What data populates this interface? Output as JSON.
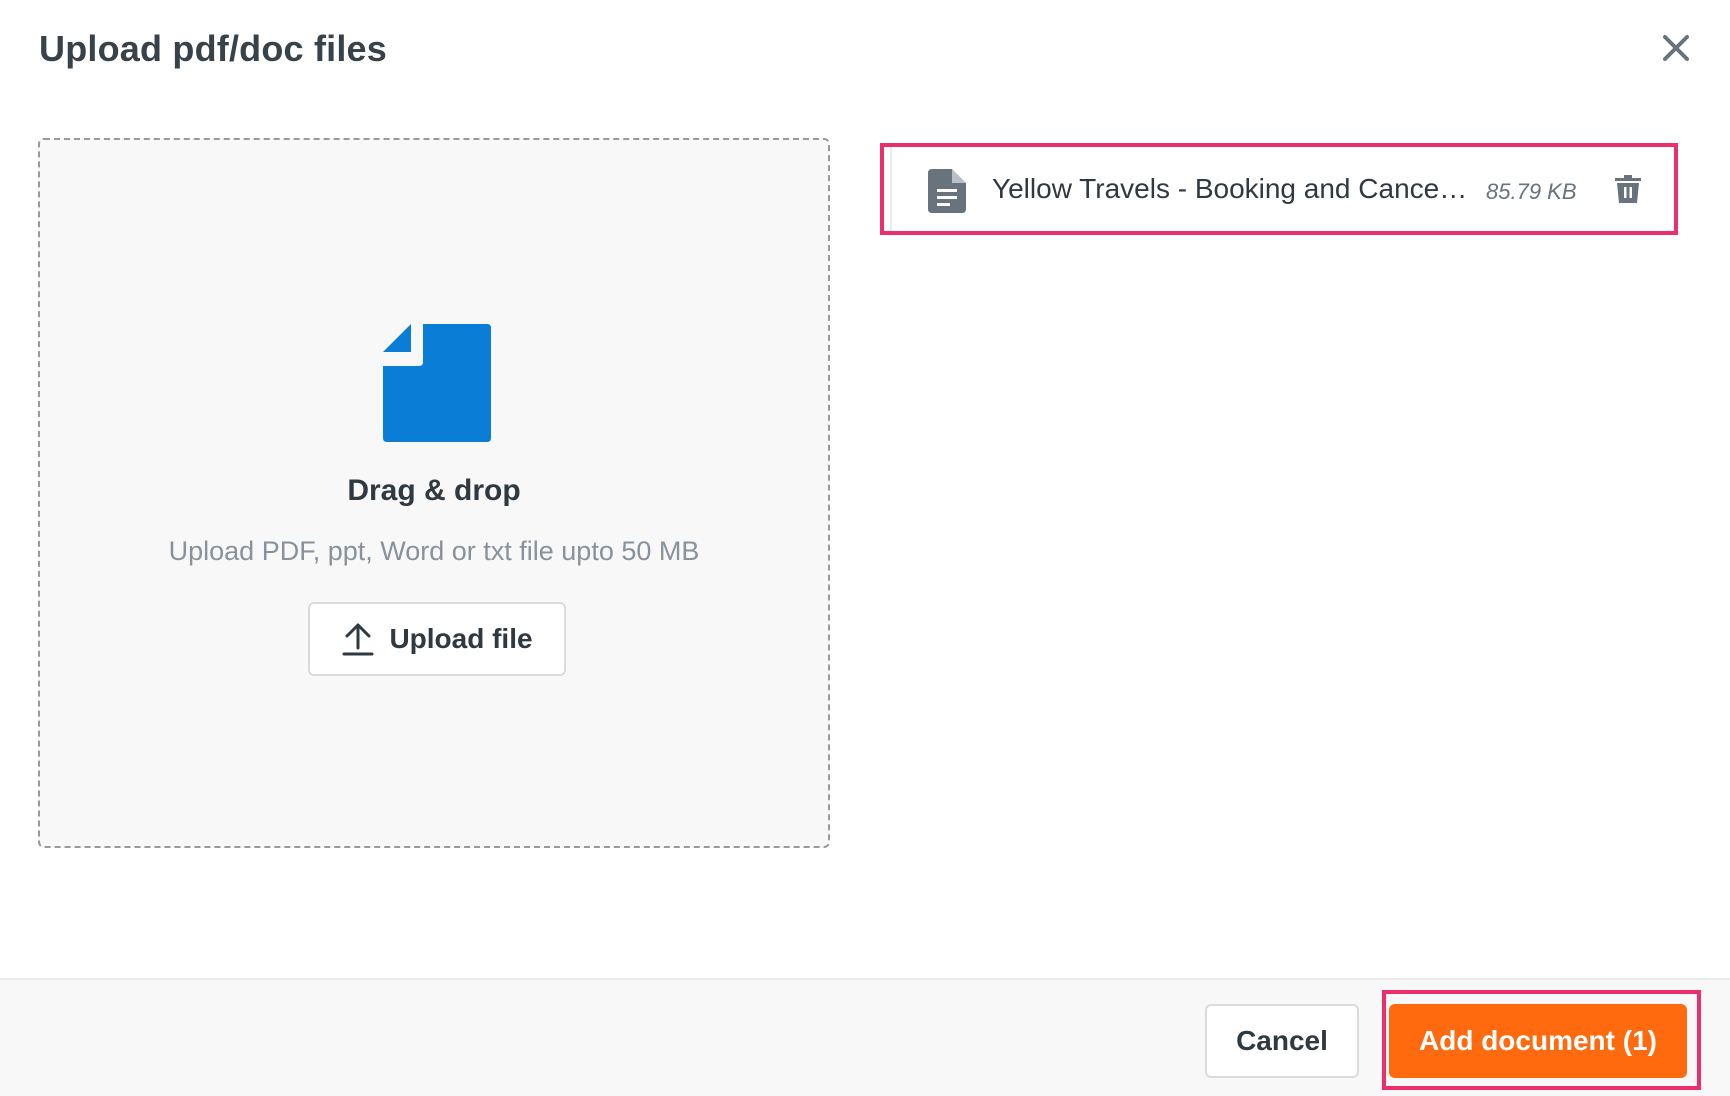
{
  "dialog": {
    "title": "Upload pdf/doc files",
    "close_icon": "close-icon"
  },
  "dropzone": {
    "icon": "document-icon",
    "title": "Drag & drop",
    "hint": "Upload PDF, ppt, Word or txt file upto 50 MB",
    "upload_button_label": "Upload file",
    "upload_icon": "upload-icon"
  },
  "files": [
    {
      "name": "Yellow Travels - Booking and Cancellation Policy",
      "size": "85.79 KB",
      "icon": "file-document-icon",
      "action_icon": "trash-icon"
    }
  ],
  "footer": {
    "cancel_label": "Cancel",
    "add_label": "Add document (1)"
  },
  "colors": {
    "accent": "#ff6a0f",
    "document_blue": "#0a7dd6",
    "highlight": "#ec2f6c",
    "text": "#2f3941",
    "muted": "#87929d"
  }
}
